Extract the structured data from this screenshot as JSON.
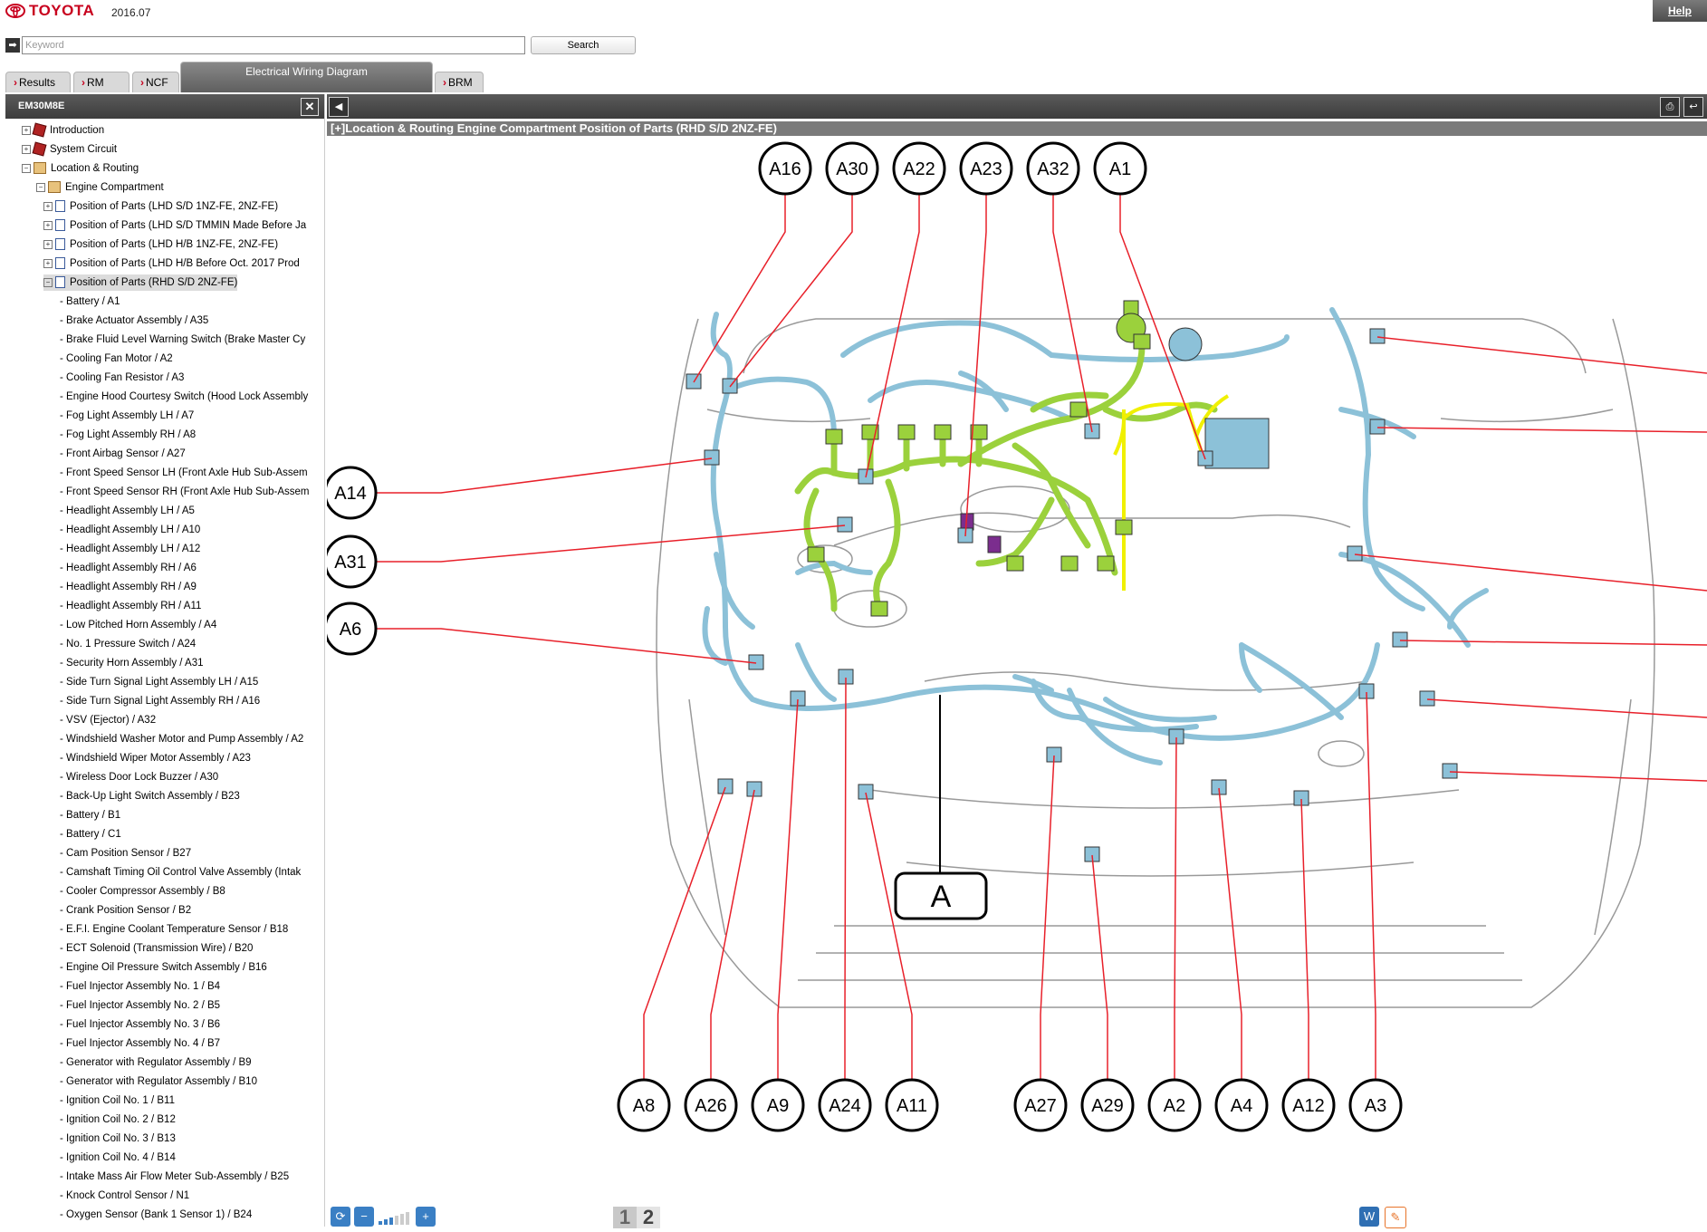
{
  "app": {
    "brand": "TOYOTA",
    "version": "2016.07",
    "help": "Help"
  },
  "search": {
    "placeholder": "Keyword",
    "button": "Search"
  },
  "tabs": [
    "Results",
    "RM",
    "NCF",
    "Electrical Wiring Diagram",
    "BRM"
  ],
  "panel": {
    "title": "EM30M8E",
    "close": "✕"
  },
  "tree": {
    "top": [
      "Introduction",
      "System Circuit",
      "Location & Routing"
    ],
    "engine": "Engine Compartment",
    "positions": [
      "Position of Parts (LHD S/D 1NZ-FE, 2NZ-FE)",
      "Position of Parts (LHD S/D TMMIN Made Before Ja",
      "Position of Parts (LHD H/B 1NZ-FE, 2NZ-FE)",
      "Position of Parts (LHD H/B Before Oct. 2017 Prod",
      "Position of Parts (RHD S/D 2NZ-FE)"
    ],
    "items": [
      "Battery / A1",
      "Brake Actuator Assembly / A35",
      "Brake Fluid Level Warning Switch (Brake Master Cy",
      "Cooling Fan Motor / A2",
      "Cooling Fan Resistor / A3",
      "Engine Hood Courtesy Switch (Hood Lock Assembly",
      "Fog Light Assembly LH / A7",
      "Fog Light Assembly RH / A8",
      "Front Airbag Sensor / A27",
      "Front Speed Sensor LH (Front Axle Hub Sub-Assem",
      "Front Speed Sensor RH (Front Axle Hub Sub-Assem",
      "Headlight Assembly LH / A5",
      "Headlight Assembly LH / A10",
      "Headlight Assembly LH / A12",
      "Headlight Assembly RH / A6",
      "Headlight Assembly RH / A9",
      "Headlight Assembly RH / A11",
      "Low Pitched Horn Assembly / A4",
      "No. 1 Pressure Switch / A24",
      "Security Horn Assembly / A31",
      "Side Turn Signal Light Assembly LH / A15",
      "Side Turn Signal Light Assembly RH / A16",
      "VSV (Ejector) / A32",
      "Windshield Washer Motor and Pump Assembly / A2",
      "Windshield Wiper Motor Assembly / A23",
      "Wireless Door Lock Buzzer / A30",
      "Back-Up Light Switch Assembly / B23",
      "Battery / B1",
      "Battery / C1",
      "Cam Position Sensor / B27",
      "Camshaft Timing Oil Control Valve Assembly (Intak",
      "Cooler Compressor Assembly / B8",
      "Crank Position Sensor / B2",
      "E.F.I. Engine Coolant Temperature Sensor / B18",
      "ECT Solenoid (Transmission Wire) / B20",
      "Engine Oil Pressure Switch Assembly / B16",
      "Fuel Injector Assembly No. 1 / B4",
      "Fuel Injector Assembly No. 2 / B5",
      "Fuel Injector Assembly No. 3 / B6",
      "Fuel Injector Assembly No. 4 / B7",
      "Generator with Regulator Assembly / B9",
      "Generator with Regulator Assembly / B10",
      "Ignition Coil No. 1 / B11",
      "Ignition Coil No. 2 / B12",
      "Ignition Coil No. 3 / B13",
      "Ignition Coil No. 4 / B14",
      "Intake Mass Air Flow Meter Sub-Assembly / B25",
      "Knock Control Sensor / N1",
      "Oxygen Sensor (Bank 1 Sensor 1) / B24"
    ]
  },
  "breadcrumb": "[+]Location & Routing  Engine Compartment  Position of Parts (RHD S/D 2NZ-FE)",
  "labels": {
    "top": [
      "A16",
      "A30",
      "A22",
      "A23",
      "A32",
      "A1"
    ],
    "left": [
      "A14",
      "A31",
      "A6"
    ],
    "bottom": [
      "A8",
      "A26",
      "A9",
      "A24",
      "A11",
      "A27",
      "A29",
      "A2",
      "A4",
      "A12",
      "A3"
    ],
    "center": "A"
  },
  "pages": [
    "1",
    "2"
  ],
  "colors": {
    "harness": "#8cc1d8",
    "engine": "#9bd13c",
    "yellow": "#f0f000",
    "leader": "#e8202a"
  }
}
